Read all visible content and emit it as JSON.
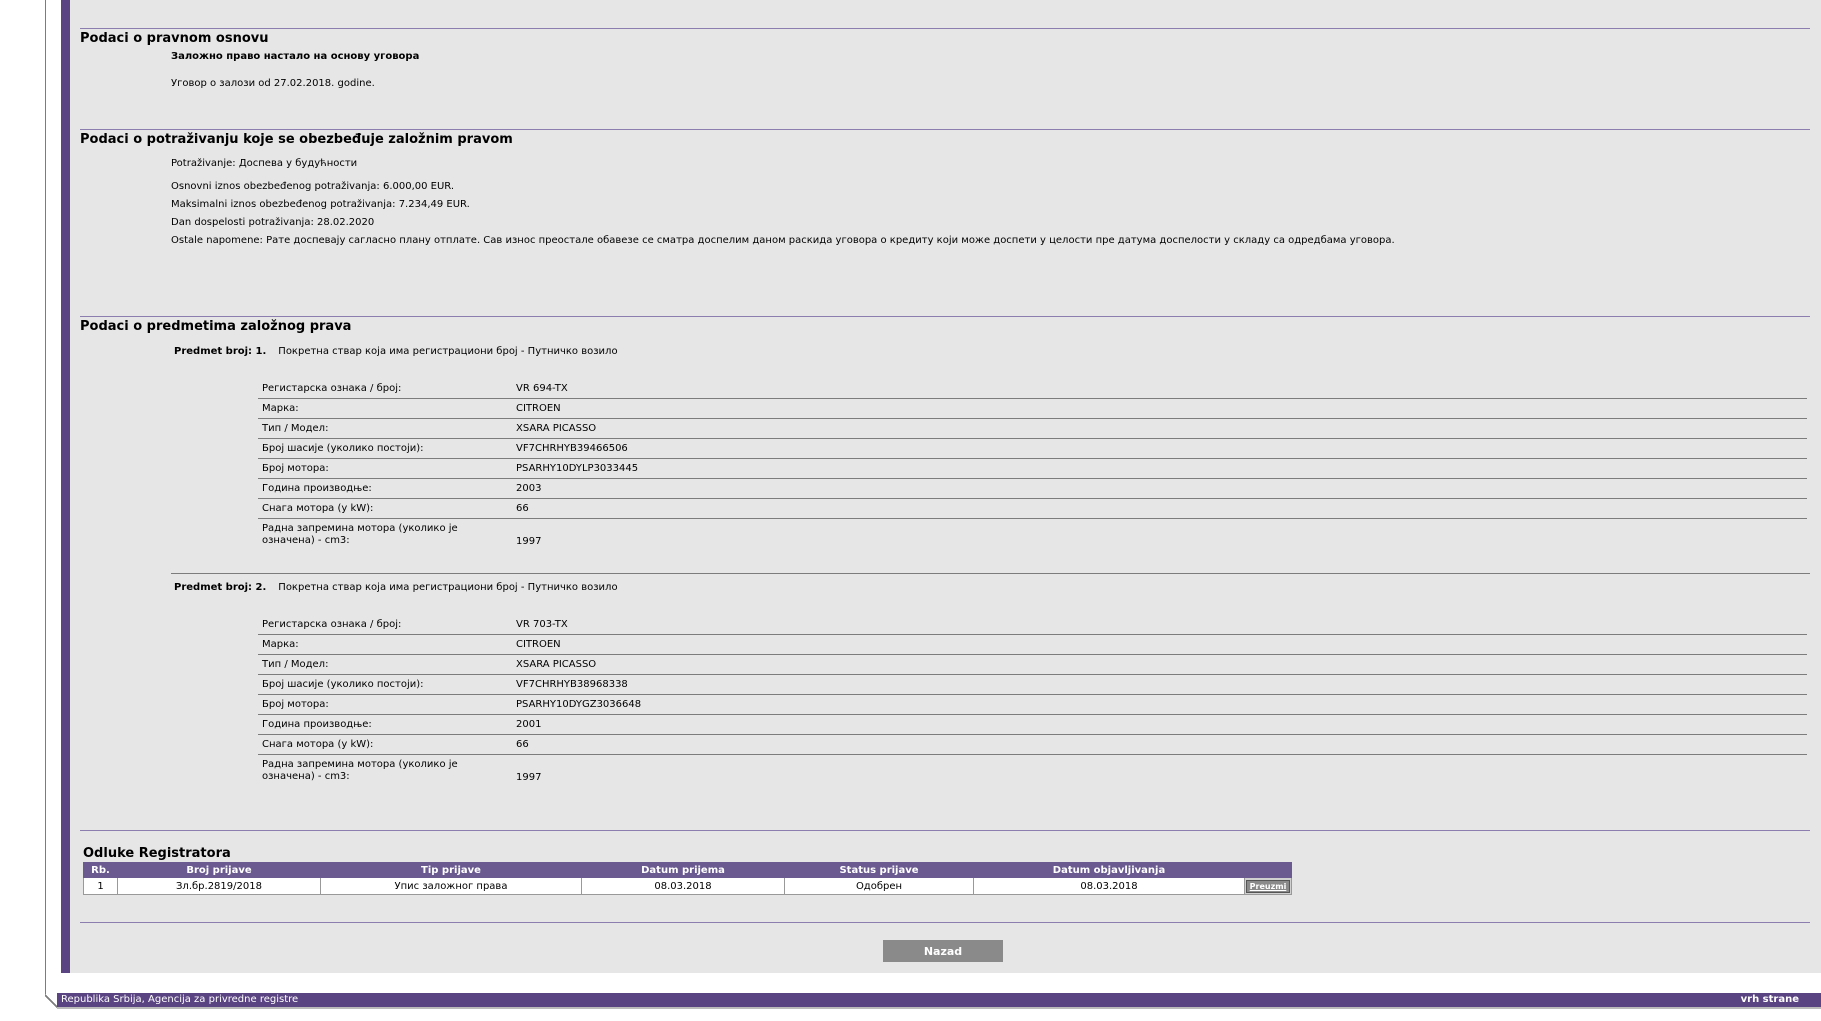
{
  "legal_basis": {
    "title": "Podaci o pravnom osnovu",
    "line1": "Заложно право настало на основу уговора",
    "line2": "Уговор о залози od 27.02.2018. godine."
  },
  "claim": {
    "title": "Podaci o potraživanju koje se obezbeđuje založnim pravom",
    "type": "Potraživanje: Доспева у будућности",
    "base_amount": "Osnovni iznos obezbeđenog potraživanja: 6.000,00 EUR.",
    "max_amount": "Maksimalni iznos obezbeđenog potraživanja: 7.234,49 EUR.",
    "due_date": "Dan dospelosti potraživanja: 28.02.2020",
    "notes": "Ostale napomene: Рате доспевају сагласно плану отплате. Сав износ преостале обавезе се сматра доспелим даном раскида уговора о кредиту који може доспети у целости пре датума доспелости у складу са одредбама уговора."
  },
  "subjects": {
    "title": "Podaci o predmetima založnog prava",
    "items": [
      {
        "label": "Predmet broj: 1.",
        "description": "Покретна ствар која има регистрациони број - Путничко возило",
        "fields": [
          {
            "key": "Регистарска ознака / број:",
            "value": "VR 694-TX"
          },
          {
            "key": "Марка:",
            "value": "CITROEN"
          },
          {
            "key": "Тип / Модел:",
            "value": "XSARA PICASSO"
          },
          {
            "key": "Број шасије (уколико постоји):",
            "value": "VF7CHRHYB39466506"
          },
          {
            "key": "Број мотора:",
            "value": "PSARHY10DYLP3033445"
          },
          {
            "key": "Година производње:",
            "value": "2003"
          },
          {
            "key": "Снага мотора (у kW):",
            "value": "66"
          },
          {
            "key": "Радна запремина мотора (уколико је означена) - cm3:",
            "value": "1997"
          }
        ]
      },
      {
        "label": "Predmet broj: 2.",
        "description": "Покретна ствар која има регистрациони број - Путничко возило",
        "fields": [
          {
            "key": "Регистарска ознака / број:",
            "value": "VR 703-TX"
          },
          {
            "key": "Марка:",
            "value": "CITROEN"
          },
          {
            "key": "Тип / Модел:",
            "value": "XSARA PICASSO"
          },
          {
            "key": "Број шасије (уколико постоји):",
            "value": "VF7CHRHYB38968338"
          },
          {
            "key": "Број мотора:",
            "value": "PSARHY10DYGZ3036648"
          },
          {
            "key": "Година производње:",
            "value": "2001"
          },
          {
            "key": "Снага мотора (у kW):",
            "value": "66"
          },
          {
            "key": "Радна запремина мотора (уколико је означена) - cm3:",
            "value": "1997"
          }
        ]
      }
    ]
  },
  "decisions": {
    "title": "Odluke Registratora",
    "columns": [
      "Rb.",
      "Broj prijave",
      "Tip prijave",
      "Datum prijema",
      "Status prijave",
      "Datum objavljivanja",
      ""
    ],
    "rows": [
      {
        "rb": "1",
        "broj": "Зл.бр.2819/2018",
        "tip": "Упис заложног права",
        "prijem": "08.03.2018",
        "status": "Одобрен",
        "objava": "08.03.2018",
        "action": "Preuzmi"
      }
    ]
  },
  "back_button": "Nazad",
  "footer": {
    "left": "Republika Srbija, Agencija za privredne registre",
    "right": "vrh strane"
  }
}
